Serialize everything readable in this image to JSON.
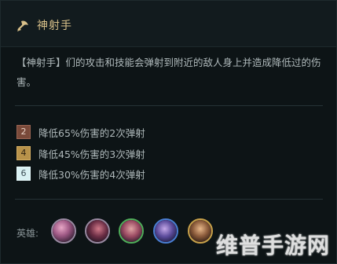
{
  "trait": {
    "name": "神射手",
    "icon": "crossbow-icon",
    "description": "【神射手】们的攻击和技能会弹射到附近的敌人身上并造成降低过的伤害。"
  },
  "tiers": [
    {
      "count": "2",
      "text": "降低65%伤害的2次弹射",
      "rank": "bronze",
      "color": "#7a4a3a"
    },
    {
      "count": "4",
      "text": "降低45%伤害的3次弹射",
      "rank": "gold",
      "color": "#b8924a"
    },
    {
      "count": "6",
      "text": "降低30%伤害的4次弹射",
      "rank": "platinum",
      "color": "#d9f1f3"
    }
  ],
  "heroes": {
    "label": "英雄:",
    "champions": [
      {
        "icon": "champion-portrait-1",
        "border": "#9a8aa2"
      },
      {
        "icon": "champion-portrait-2",
        "border": "#9a8aa2"
      },
      {
        "icon": "champion-portrait-3",
        "border": "#4fae5a"
      },
      {
        "icon": "champion-portrait-4",
        "border": "#4a7fd4"
      },
      {
        "icon": "champion-portrait-5",
        "border": "#c9a24a"
      }
    ]
  },
  "watermark": "维普手游网"
}
